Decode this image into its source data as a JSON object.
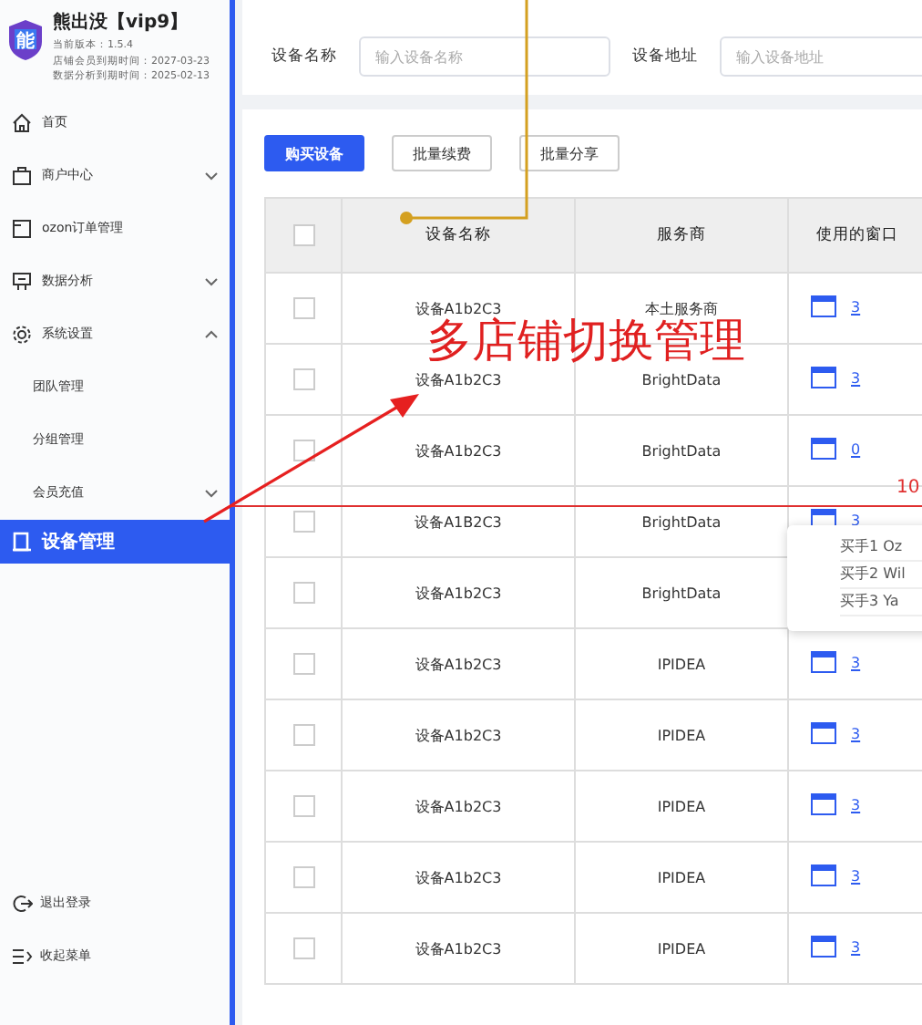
{
  "app": {
    "logo_text": "能",
    "title": "熊出没【vip9】",
    "info": [
      "当前版本：1.5.4",
      "店铺会员到期时间：2027-03-23",
      "数据分析到期时间：2025-02-13"
    ]
  },
  "sidebar": {
    "items": [
      {
        "label": "首页",
        "selected": false
      },
      {
        "label": "商户中心",
        "selected": false,
        "expanded": false
      },
      {
        "label": "ozon订单管理",
        "selected": false
      },
      {
        "label": "数据分析",
        "selected": false,
        "expanded": false
      },
      {
        "label": "系统设置",
        "selected": false,
        "expanded": true,
        "children": [
          {
            "label": "团队管理",
            "selected": false
          },
          {
            "label": "分组管理",
            "selected": false
          },
          {
            "label": "会员充值",
            "selected": false,
            "expanded": false
          }
        ]
      },
      {
        "label": "设备管理",
        "selected": true
      }
    ],
    "footer": [
      "退出登录",
      "收起菜单"
    ]
  },
  "filters": [
    {
      "label": "设备名称",
      "placeholder": "输入设备名称"
    },
    {
      "label": "设备地址",
      "placeholder": "输入设备地址"
    }
  ],
  "buttons": [
    {
      "label": "购买设备",
      "primary": true
    },
    {
      "label": "批量续费",
      "primary": false
    },
    {
      "label": "批量分享",
      "primary": false
    }
  ],
  "table": {
    "header_checked": false,
    "columns": [
      "设备名称",
      "服务商",
      "使用的窗口"
    ],
    "rows": [
      {
        "checked": false,
        "name": "设备A1b2C3",
        "provider": "本土服务商",
        "windows": "3"
      },
      {
        "checked": false,
        "name": "设备A1b2C3",
        "provider": "BrightData",
        "windows": "3"
      },
      {
        "checked": false,
        "name": "设备A1b2C3",
        "provider": "BrightData",
        "windows": "0"
      },
      {
        "checked": false,
        "name": "设备A1B2C3",
        "provider": "BrightData",
        "windows": "3"
      },
      {
        "checked": false,
        "name": "设备A1b2C3",
        "provider": "BrightData"
      },
      {
        "checked": false,
        "name": "设备A1b2C3",
        "provider": "IPIDEA",
        "windows": "3"
      },
      {
        "checked": false,
        "name": "设备A1b2C3",
        "provider": "IPIDEA",
        "windows": "3"
      },
      {
        "checked": false,
        "name": "设备A1b2C3",
        "provider": "IPIDEA",
        "windows": "3"
      },
      {
        "checked": false,
        "name": "设备A1b2C3",
        "provider": "IPIDEA",
        "windows": "3"
      },
      {
        "checked": false,
        "name": "设备A1b2C3",
        "provider": "IPIDEA",
        "windows": "3"
      }
    ]
  },
  "tooltip": {
    "items": [
      "买手1 Oz",
      "买手2 Wil",
      "买手3 Ya"
    ]
  },
  "annotations": {
    "callout": "多店铺切换管理",
    "marker": "10"
  }
}
